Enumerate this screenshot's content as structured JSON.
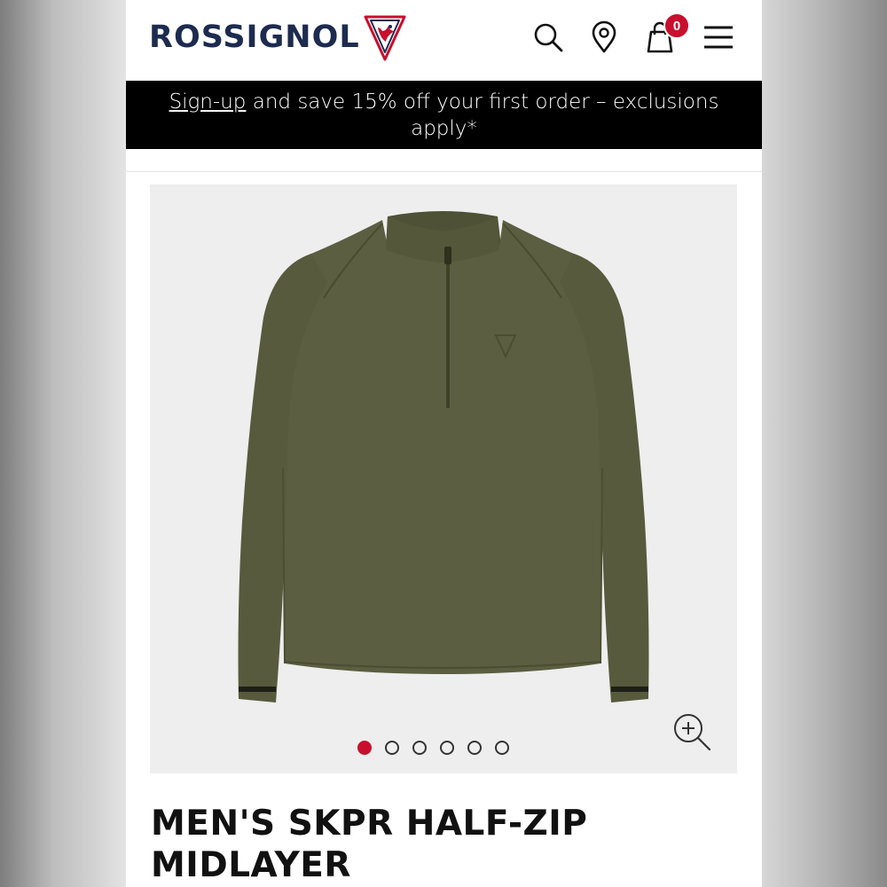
{
  "header": {
    "brand": "ROSSIGNOL",
    "icons": [
      "search-icon",
      "location-pin-icon",
      "shopping-bag-icon",
      "menu-icon"
    ],
    "cart_count": "0"
  },
  "promo": {
    "link_text": "Sign-up",
    "text": " and save 15% off your first order – exclusions apply*"
  },
  "colors": {
    "accent": "#c8102e",
    "brand_navy": "#1d2b4f",
    "product_olive": "#5b5e40",
    "promo_bg": "#000000"
  },
  "gallery": {
    "slide_count": 6,
    "active_slide": 1,
    "zoom_icon": "zoom-in-icon"
  },
  "product": {
    "title": "MEN'S SKPR HALF-ZIP MIDLAYER"
  }
}
